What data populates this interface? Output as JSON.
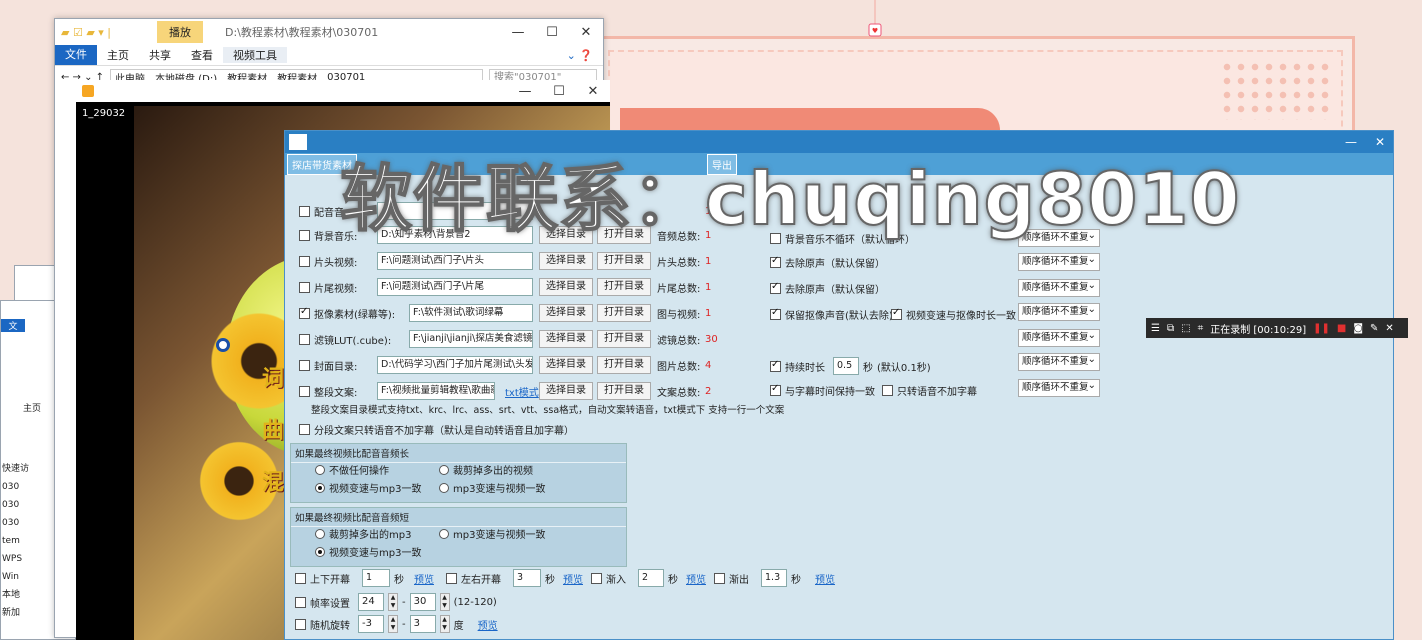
{
  "explorer": {
    "context_tab": "播放",
    "path_title": "D:\\教程素材\\教程素材\\030701",
    "ribbon": [
      "文件",
      "主页",
      "共享",
      "查看",
      "视频工具"
    ],
    "breadcrumb": [
      "此电脑",
      "本地磁盘 (D:)",
      "教程素材",
      "教程素材",
      "030701"
    ],
    "search_placeholder": "搜索\"030701\""
  },
  "player": {
    "label": "1_29032",
    "subtitle_chars": "词曲混"
  },
  "left_list": [
    "快速访",
    "030",
    "030",
    "030",
    "tem",
    "WPS",
    "Win",
    "本地",
    "新加"
  ],
  "left_small": [
    "文",
    "文",
    "主页"
  ],
  "app": {
    "tabs": [
      "探店带货素材",
      "导出"
    ],
    "watermark": "软件联系：chuqing8010",
    "rows": [
      {
        "label": "配音音",
        "field": "",
        "count_label": "",
        "count": "1",
        "checked": false
      },
      {
        "label": "背景音乐:",
        "field": "D:\\知乎素材\\背景音2",
        "count_label": "音频总数:",
        "count": "1",
        "checked": false
      },
      {
        "label": "片头视频:",
        "field": "F:\\问题测试\\西门子\\片头",
        "count_label": "片头总数:",
        "count": "1",
        "checked": false
      },
      {
        "label": "片尾视频:",
        "field": "F:\\问题测试\\西门子\\片尾",
        "count_label": "片尾总数:",
        "count": "1",
        "checked": false
      },
      {
        "label": "抠像素材(绿幕等):",
        "field": "F:\\软件测试\\歌词绿幕",
        "count_label": "图与视频:",
        "count": "1",
        "checked": true
      },
      {
        "label": "滤镜LUT(.cube):",
        "field": "F:\\jianji\\jianji\\探店美食滤镜",
        "count_label": "滤镜总数:",
        "count": "30",
        "checked": false
      },
      {
        "label": "封面目录:",
        "field": "D:\\代码学习\\西门子加片尾测试\\头发护",
        "count_label": "图片总数:",
        "count": "4",
        "checked": false
      },
      {
        "label": "整段文案:",
        "field": "F:\\视频批量剪辑教程\\歌曲歌",
        "count_label": "文案总数:",
        "count": "2",
        "checked": false
      }
    ],
    "btn_select": "选择目录",
    "btn_open": "打开目录",
    "txt_mode": "txt模式",
    "note": "整段文案目录模式支持txt、krc、lrc、ass、srt、vtt、ssa格式，自动文案转语音，txt模式下 支持一行一个文案",
    "segment_label": "分段文案只转语音不加字幕（默认是自动转语音且加字幕）",
    "right_opts": [
      {
        "label": "背景音乐不循环（默认循环）",
        "checked": false
      },
      {
        "label": "去除原声（默认保留）",
        "checked": true
      },
      {
        "label": "去除原声（默认保留）",
        "checked": true
      },
      {
        "label": "保留抠像声音(默认去除)",
        "checked": true
      },
      {
        "label": "视频变速与抠像时长一致",
        "checked": true
      },
      {
        "label": "持续时长",
        "checked": true
      },
      {
        "label": "与字幕时间保持一致",
        "checked": true
      },
      {
        "label": "只转语音不加字幕",
        "checked": false
      }
    ],
    "duration_value": "0.5",
    "duration_unit": "秒",
    "duration_hint": "(默认0.1秒)",
    "select_value": "顺序循环不重复",
    "group1": {
      "title": "如果最终视频比配音音频长",
      "opts": [
        "不做任何操作",
        "裁剪掉多出的视频",
        "视频变速与mp3一致",
        "mp3变速与视频一致"
      ],
      "selected": 2
    },
    "group2": {
      "title": "如果最终视频比配音音频短",
      "opts": [
        "裁剪掉多出的mp3",
        "mp3变速与视频一致",
        "视频变速与mp3一致"
      ],
      "selected": 2
    },
    "effects": [
      {
        "label": "上下开幕",
        "value": "1"
      },
      {
        "label": "左右开幕",
        "value": "3"
      },
      {
        "label": "渐入",
        "value": "2"
      },
      {
        "label": "渐出",
        "value": "1.3"
      }
    ],
    "sec": "秒",
    "preview": "预览",
    "fps_label": "帧率设置",
    "fps_from": "24",
    "fps_to": "30",
    "fps_range": "(12-120)",
    "rot_label": "随机旋转",
    "rot_from": "-3",
    "rot_to": "3",
    "rot_unit": "度",
    "dash": "-"
  },
  "recorder": {
    "status": "正在录制 [00:10:29]"
  },
  "colors": {
    "accent": "#2a7fc3",
    "count": "#d22222",
    "app_bg": "#d5e6ef"
  }
}
